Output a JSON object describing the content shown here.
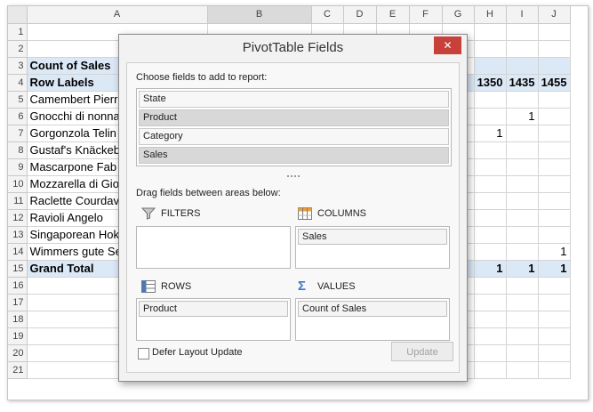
{
  "columns": [
    "A",
    "B",
    "C",
    "D",
    "E",
    "F",
    "G",
    "H",
    "I",
    "J"
  ],
  "rows": [
    {
      "n": "1",
      "a": "",
      "vals": [
        "",
        "",
        "",
        "",
        "",
        "",
        "",
        "",
        ""
      ]
    },
    {
      "n": "2",
      "a": "",
      "vals": [
        "",
        "",
        "",
        "",
        "",
        "",
        "",
        "",
        ""
      ]
    },
    {
      "n": "3",
      "a": "Count of Sales",
      "vals": [
        "",
        "",
        "",
        "",
        "",
        "",
        "",
        "",
        ""
      ]
    },
    {
      "n": "4",
      "a": "Row Labels",
      "vals": [
        "",
        "",
        "",
        "",
        "",
        "",
        "1350",
        "1435",
        "1455"
      ]
    },
    {
      "n": "5",
      "a": "Camembert Pierr",
      "vals": [
        "",
        "",
        "",
        "",
        "",
        "",
        "",
        "",
        ""
      ]
    },
    {
      "n": "6",
      "a": "Gnocchi di nonna",
      "vals": [
        "",
        "",
        "",
        "",
        "",
        "",
        "",
        "1",
        ""
      ]
    },
    {
      "n": "7",
      "a": "Gorgonzola Telin",
      "vals": [
        "",
        "",
        "",
        "",
        "",
        "",
        "1",
        "",
        ""
      ]
    },
    {
      "n": "8",
      "a": "Gustaf's Knäckeb",
      "vals": [
        "",
        "",
        "",
        "",
        "",
        "",
        "",
        "",
        ""
      ]
    },
    {
      "n": "9",
      "a": "Mascarpone Fab",
      "vals": [
        "",
        "",
        "",
        "",
        "",
        "",
        "",
        "",
        ""
      ]
    },
    {
      "n": "10",
      "a": "Mozzarella di Gio",
      "vals": [
        "",
        "",
        "",
        "",
        "",
        "",
        "",
        "",
        ""
      ]
    },
    {
      "n": "11",
      "a": "Raclette Courdav",
      "vals": [
        "",
        "",
        "",
        "",
        "",
        "",
        "",
        "",
        ""
      ]
    },
    {
      "n": "12",
      "a": "Ravioli Angelo",
      "vals": [
        "",
        "",
        "",
        "",
        "",
        "",
        "",
        "",
        ""
      ]
    },
    {
      "n": "13",
      "a": "Singaporean Hok",
      "vals": [
        "",
        "",
        "",
        "",
        "",
        "",
        "",
        "",
        ""
      ]
    },
    {
      "n": "14",
      "a": "Wimmers gute Se",
      "vals": [
        "",
        "",
        "",
        "",
        "",
        "",
        "",
        "",
        "1"
      ]
    },
    {
      "n": "15",
      "a": "Grand Total",
      "vals": [
        "",
        "",
        "",
        "",
        "",
        "",
        "1",
        "1",
        "1"
      ]
    },
    {
      "n": "16",
      "a": "",
      "vals": [
        "",
        "",
        "",
        "",
        "",
        "",
        "",
        "",
        ""
      ]
    },
    {
      "n": "17",
      "a": "",
      "vals": [
        "",
        "",
        "",
        "",
        "",
        "",
        "",
        "",
        ""
      ]
    },
    {
      "n": "18",
      "a": "",
      "vals": [
        "",
        "",
        "",
        "",
        "",
        "",
        "",
        "",
        ""
      ]
    },
    {
      "n": "19",
      "a": "",
      "vals": [
        "",
        "",
        "",
        "",
        "",
        "",
        "",
        "",
        ""
      ]
    },
    {
      "n": "20",
      "a": "",
      "vals": [
        "",
        "",
        "",
        "",
        "",
        "",
        "",
        "",
        ""
      ]
    },
    {
      "n": "21",
      "a": "",
      "vals": [
        "",
        "",
        "",
        "",
        "",
        "",
        "",
        "",
        ""
      ]
    }
  ],
  "dialog": {
    "title": "PivotTable Fields",
    "close_glyph": "✕",
    "choose_label": "Choose fields to add to report:",
    "fields": [
      {
        "label": "State",
        "selected": false
      },
      {
        "label": "Product",
        "selected": true
      },
      {
        "label": "Category",
        "selected": false
      },
      {
        "label": "Sales",
        "selected": true
      }
    ],
    "drag_label": "Drag fields between areas below:",
    "areas": {
      "filters": {
        "label": "FILTERS",
        "icon": "filter-icon",
        "items": []
      },
      "columns": {
        "label": "COLUMNS",
        "icon": "columns-icon",
        "items": [
          "Sales"
        ]
      },
      "rows": {
        "label": "ROWS",
        "icon": "rows-icon",
        "items": [
          "Product"
        ]
      },
      "values": {
        "label": "VALUES",
        "icon": "sigma-icon",
        "items": [
          "Count of Sales"
        ]
      }
    },
    "defer_label": "Defer Layout Update",
    "defer_checked": false,
    "update_label": "Update"
  },
  "colors": {
    "pivot_highlight": "#dbe9f7",
    "close_button": "#c7413a",
    "icon_blue": "#3f79c6",
    "icon_orange": "#e8a040"
  }
}
